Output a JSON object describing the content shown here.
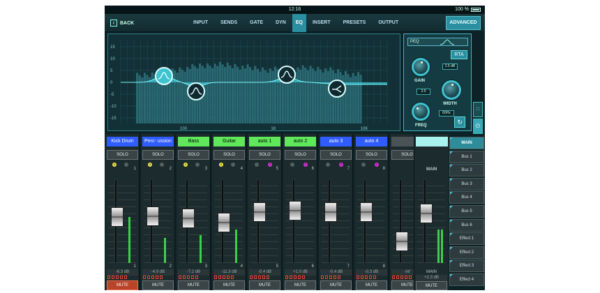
{
  "status": {
    "time": "12:16",
    "battery": "100 %"
  },
  "nav": {
    "back_label": "BACK",
    "tabs": [
      "INPUT",
      "SENDS",
      "GATE",
      "DYN",
      "EQ",
      "INSERT",
      "PRESETS",
      "OUTPUT"
    ],
    "active_tab": "EQ",
    "advanced_label": "ADVANCED"
  },
  "eq": {
    "y_ticks": [
      "15",
      "10",
      "5",
      "0",
      "-5",
      "-10",
      "-15"
    ],
    "x_ticks": [
      "100",
      "1K",
      "10K"
    ]
  },
  "peq": {
    "mode_label": "PEQ",
    "rta_label": "RTA",
    "gain_label": "GAIN",
    "gain_value": "2.5 dB",
    "width_label": "WIDTH",
    "width_value": "2.0",
    "freq_label": "FREQ",
    "freq_value": "60Hz"
  },
  "channels": [
    {
      "name": "Kick Drum",
      "color": "#2f5cff",
      "text_color": "#ffffff",
      "solo": "SOLO",
      "mute": "MUTE",
      "mute_on": true,
      "group": "1",
      "group_color": "#f2e84a",
      "num": "1",
      "db": "-6.3 dB",
      "fader_level": 0.56,
      "meter_level": 0.55
    },
    {
      "name": "Perc- ussion",
      "color": "#2f5cff",
      "text_color": "#ffffff",
      "solo": "SOLO",
      "mute": "MUTE",
      "mute_on": false,
      "group": "1",
      "group_color": "#f2e84a",
      "num": "2",
      "db": "-4.9 dB",
      "fader_level": 0.58,
      "meter_level": 0.3
    },
    {
      "name": "Bass",
      "color": "#5ee85a",
      "text_color": "#000000",
      "solo": "SOLO",
      "mute": "MUTE",
      "mute_on": false,
      "group": "1",
      "group_color": "#f2e84a",
      "num": "3",
      "db": "-7.2 dB",
      "fader_level": 0.54,
      "meter_level": 0.33
    },
    {
      "name": "Guitar",
      "color": "#5ee85a",
      "text_color": "#000000",
      "solo": "SOLO",
      "mute": "MUTE",
      "mute_on": false,
      "group": "1",
      "group_color": "#f2e84a",
      "num": "4",
      "db": "-11.3 dB",
      "fader_level": 0.48,
      "meter_level": 0.4
    },
    {
      "name": "auto 1",
      "color": "#5ee85a",
      "text_color": "#000000",
      "solo": "SOLO",
      "mute": "MUTE",
      "mute_on": false,
      "group": "T",
      "group_color": "#d830d8",
      "num": "5",
      "db": "-0.4 dB",
      "fader_level": 0.64,
      "meter_level": 0
    },
    {
      "name": "auto 2",
      "color": "#5ee85a",
      "text_color": "#000000",
      "solo": "SOLO",
      "mute": "MUTE",
      "mute_on": false,
      "group": "T",
      "group_color": "#d830d8",
      "num": "6",
      "db": "+1.0 dB",
      "fader_level": 0.66,
      "meter_level": 0
    },
    {
      "name": "auto 3",
      "color": "#2f5cff",
      "text_color": "#ffffff",
      "solo": "SOLO",
      "mute": "MUTE",
      "mute_on": false,
      "group": "T",
      "group_color": "#d830d8",
      "num": "7",
      "db": "-0.4 dB",
      "fader_level": 0.64,
      "meter_level": 0
    },
    {
      "name": "auto 4",
      "color": "#2f5cff",
      "text_color": "#ffffff",
      "solo": "SOLO",
      "mute": "MUTE",
      "mute_on": false,
      "group": "T",
      "group_color": "#d830d8",
      "num": "8",
      "db": "-0.3 dB",
      "fader_level": 0.64,
      "meter_level": 0
    },
    {
      "name": "",
      "color": "#4a5456",
      "text_color": "#ffffff",
      "solo": "SOLO",
      "mute": "MUTE",
      "mute_on": false,
      "group": "",
      "group_color": "#4a5456",
      "num": "",
      "db": "-inf",
      "fader_level": 0.18,
      "meter_level": 0
    }
  ],
  "main": {
    "top_label": "MAIN",
    "bottom_label": "MAIN",
    "db": "+2.3 dB",
    "mute": "MUTE",
    "fader_level": 0.62,
    "meter_level": 0.4
  },
  "bus_list": [
    "MAIN",
    "Bus 1",
    "Bus 2",
    "Bus 3",
    "Bus 4",
    "Bus 5",
    "Bus 6",
    "Effect 1",
    "Effect 2",
    "Effect 3",
    "Effect 4"
  ],
  "bus_active": "MAIN"
}
